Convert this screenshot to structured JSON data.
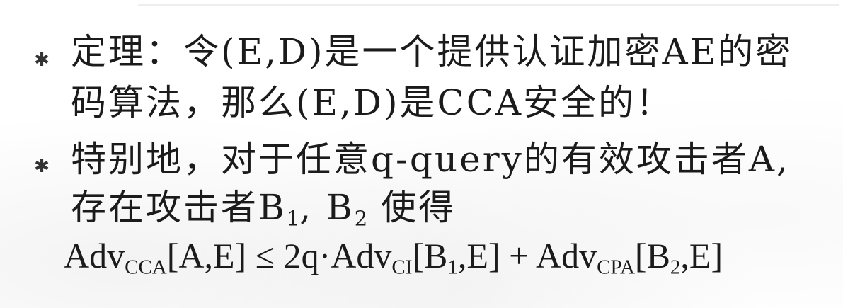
{
  "bullets": [
    {
      "icon": "asterisk-bullet-icon",
      "lines": [
        "定理：令(E,D)是一个提供认证加密AE的密",
        "码算法，那么(E,D)是CCA安全的！"
      ]
    },
    {
      "icon": "asterisk-bullet-icon",
      "line1": "特别地，对于任意q-query的有效攻击者A,",
      "line2": {
        "prefix": "存在攻击者B",
        "sub1": "1",
        "middle": ", B",
        "sub2": "2",
        "suffix": " 使得"
      }
    }
  ],
  "formula": {
    "adv1": "Adv",
    "sub_cca": "CCA",
    "args1": "[A,E] ≤ 2q·Adv",
    "sub_ci": "CI",
    "args2_pre": "[B",
    "args2_sub": "1",
    "args2_post": ",E] + Adv",
    "sub_cpa": "CPA",
    "args3_pre": "[B",
    "args3_sub": "2",
    "args3_post": ",E]"
  }
}
